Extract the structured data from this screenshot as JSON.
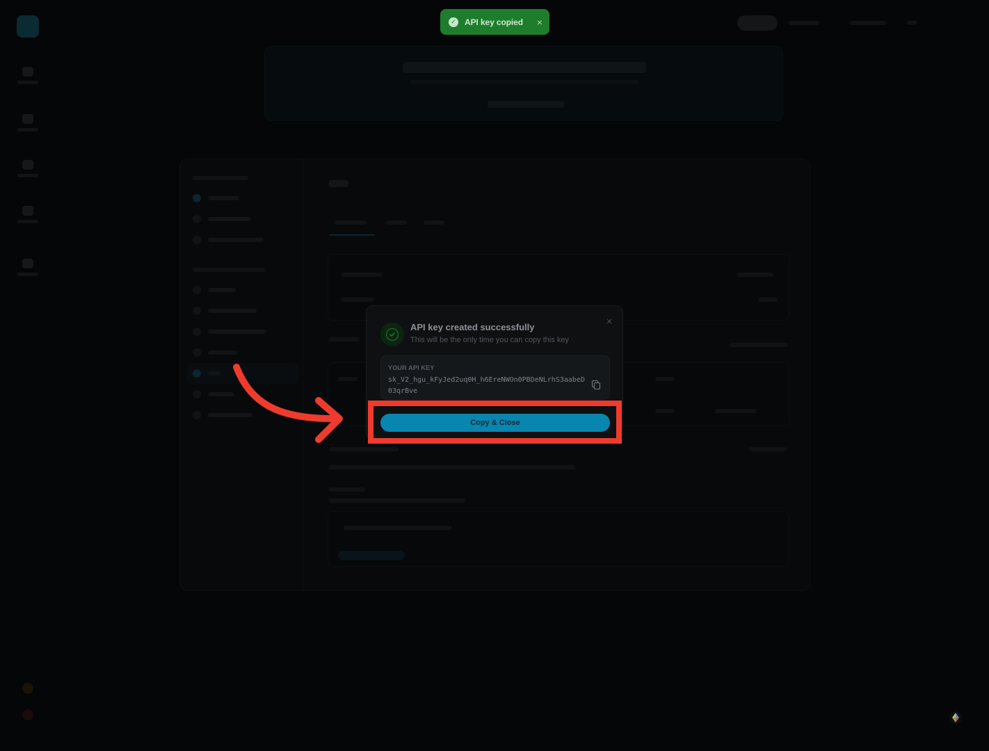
{
  "toast": {
    "message": "API key copied",
    "close_icon": "close-icon",
    "color": "#1e7d2c"
  },
  "modal": {
    "title": "API key created successfully",
    "subtitle": "This will be the only time you can copy this key",
    "key_label": "YOUR API KEY",
    "key_value": "sk_V2_hgu_kFyJed2uq0H_h6EreNWOn0PBDeNLrhS3aabeD03qrBve",
    "copy_icon": "copy-icon",
    "primary_button_label": "Copy & Close",
    "accent_color": "#0986b0"
  },
  "annotation": {
    "highlight_color": "#ef3b2d"
  }
}
